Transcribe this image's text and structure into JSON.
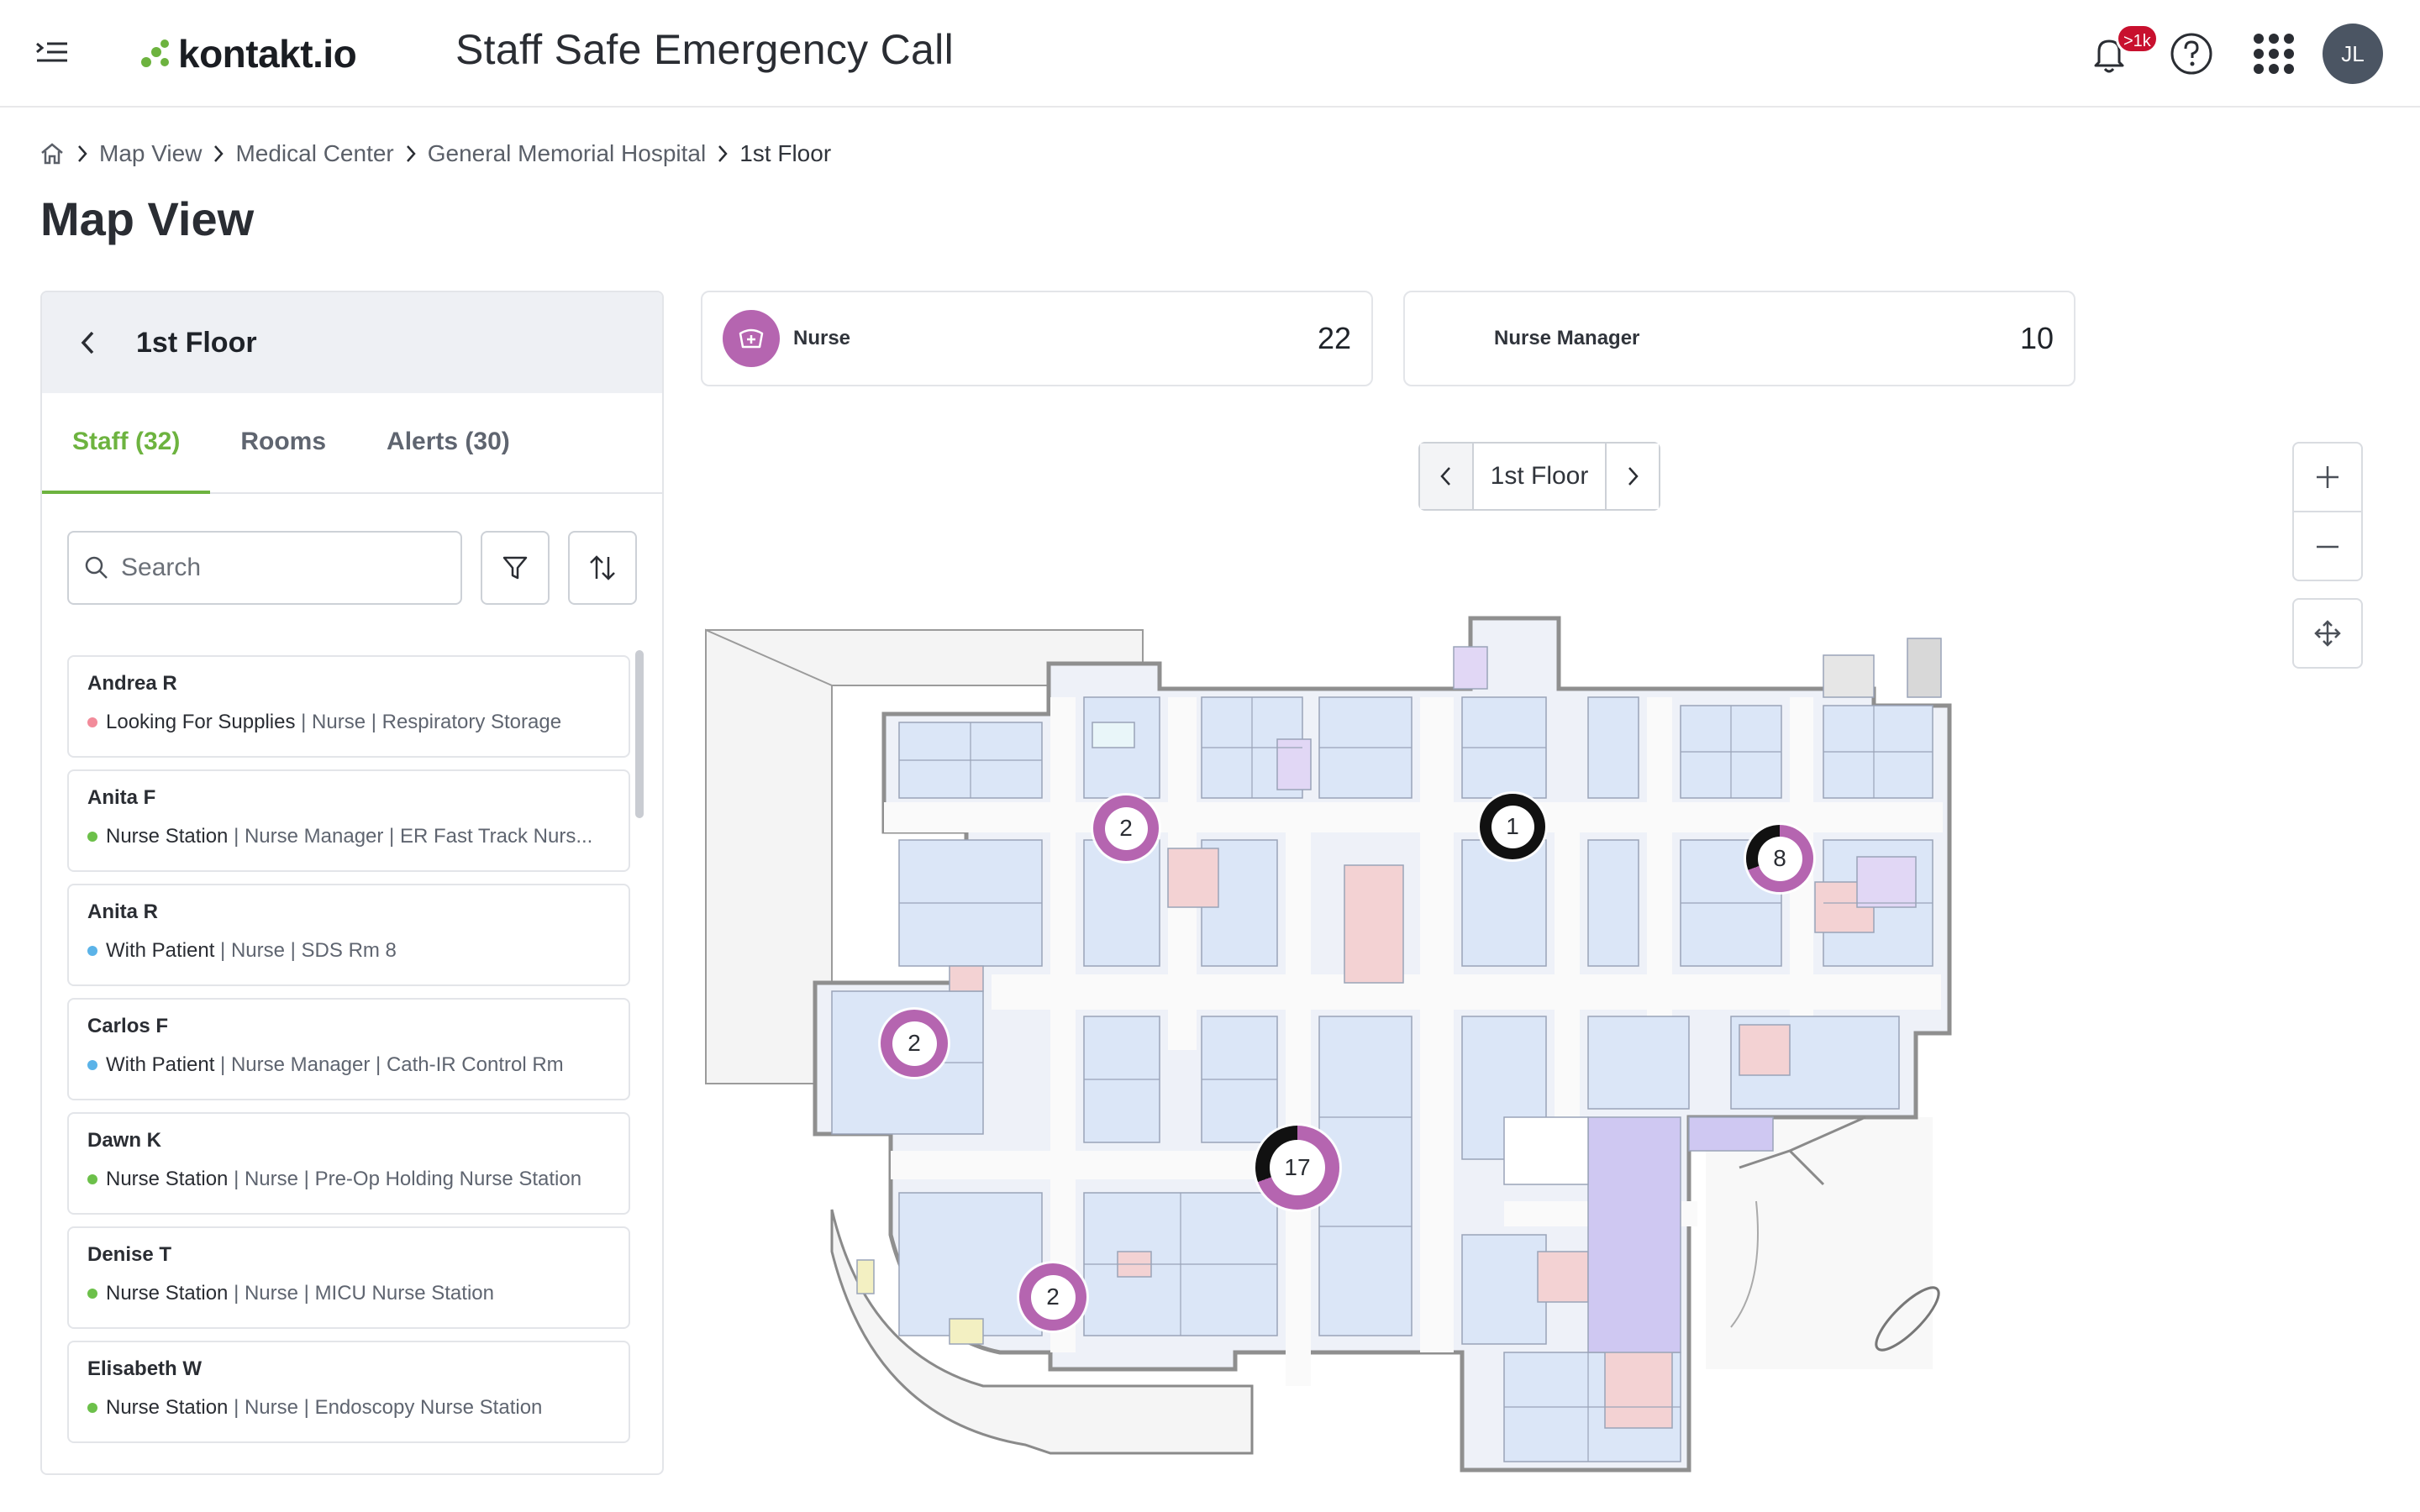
{
  "header": {
    "logo_text": "kontakt.io",
    "app_title": "Staff Safe Emergency Call",
    "notifications_badge": ">1k",
    "avatar_initials": "JL"
  },
  "breadcrumb": {
    "items": [
      "Map View",
      "Medical Center",
      "General Memorial Hospital",
      "1st Floor"
    ]
  },
  "page_title": "Map View",
  "panel": {
    "title": "1st Floor",
    "tabs": [
      {
        "label": "Staff (32)",
        "active": true
      },
      {
        "label": "Rooms",
        "active": false
      },
      {
        "label": "Alerts (30)",
        "active": false
      }
    ],
    "search_placeholder": "Search",
    "staff": [
      {
        "name": "Andrea R",
        "status": "Looking For Supplies",
        "detail": " | Nurse | Respiratory Storage",
        "dot": "#f28b9a"
      },
      {
        "name": "Anita F",
        "status": "Nurse Station",
        "detail": " | Nurse Manager | ER Fast Track Nurs...",
        "dot": "#6cc04a"
      },
      {
        "name": "Anita R",
        "status": "With Patient",
        "detail": " | Nurse | SDS Rm 8",
        "dot": "#5bb3e8"
      },
      {
        "name": "Carlos F",
        "status": "With Patient",
        "detail": " | Nurse Manager | Cath-IR Control Rm",
        "dot": "#5bb3e8"
      },
      {
        "name": "Dawn K",
        "status": "Nurse Station",
        "detail": " | Nurse | Pre-Op Holding Nurse Station",
        "dot": "#6cc04a"
      },
      {
        "name": "Denise T",
        "status": "Nurse Station",
        "detail": " | Nurse | MICU Nurse Station",
        "dot": "#6cc04a"
      },
      {
        "name": "Elisabeth W",
        "status": "Nurse Station",
        "detail": " | Nurse | Endoscopy Nurse Station",
        "dot": "#6cc04a"
      }
    ]
  },
  "counters": [
    {
      "label": "Nurse",
      "value": "22"
    },
    {
      "label": "Nurse Manager",
      "value": "10"
    }
  ],
  "floor_switch": {
    "label": "1st Floor"
  },
  "map": {
    "clusters": [
      {
        "count": "2",
        "style": "nurse"
      },
      {
        "count": "1",
        "style": "manager"
      },
      {
        "count": "8",
        "style": "mixed"
      },
      {
        "count": "2",
        "style": "nurse"
      },
      {
        "count": "17",
        "style": "mixed"
      },
      {
        "count": "2",
        "style": "nurse"
      }
    ]
  },
  "colors": {
    "brand_green": "#6db33f",
    "nurse_purple": "#b565b0",
    "manager_black": "#111111",
    "badge_red": "#c8102e"
  }
}
